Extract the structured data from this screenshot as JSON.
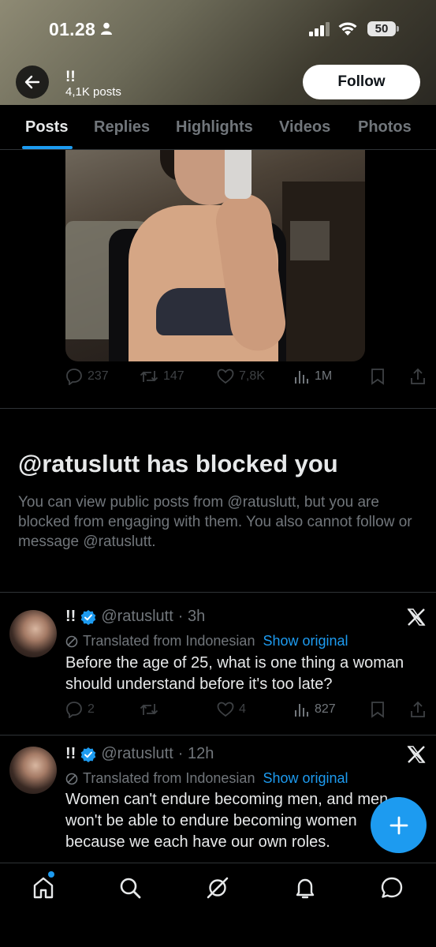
{
  "status_bar": {
    "time": "01.28",
    "battery": "50"
  },
  "profile": {
    "name": "!!",
    "post_count": "4,1K posts",
    "follow_label": "Follow"
  },
  "tabs": [
    {
      "label": "Posts"
    },
    {
      "label": "Replies"
    },
    {
      "label": "Highlights"
    },
    {
      "label": "Videos"
    },
    {
      "label": "Photos"
    }
  ],
  "first_post": {
    "replies": "237",
    "reposts": "147",
    "likes": "7,8K",
    "views": "1M"
  },
  "blocked_notice": {
    "title": "@ratuslutt has blocked you",
    "description": "You can view public posts from @ratuslutt, but you are blocked from engaging with them. You also cannot follow or message @ratuslutt."
  },
  "tweets": [
    {
      "name": "!!",
      "handle": "@ratuslutt",
      "time": "· 3h",
      "translated": "Translated from Indonesian",
      "show_original": "Show original",
      "text": "Before the age of 25, what is one thing a woman should understand before it's too late?",
      "replies": "2",
      "likes": "4",
      "views": "827"
    },
    {
      "name": "!!",
      "handle": "@ratuslutt",
      "time": "· 12h",
      "translated": "Translated from Indonesian",
      "show_original": "Show original",
      "text": "Women can't endure becoming men, and men won't be able to endure becoming women because we each have our own roles."
    }
  ],
  "colors": {
    "accent": "#1d9bf0",
    "muted": "#71767b",
    "background": "#000000"
  }
}
